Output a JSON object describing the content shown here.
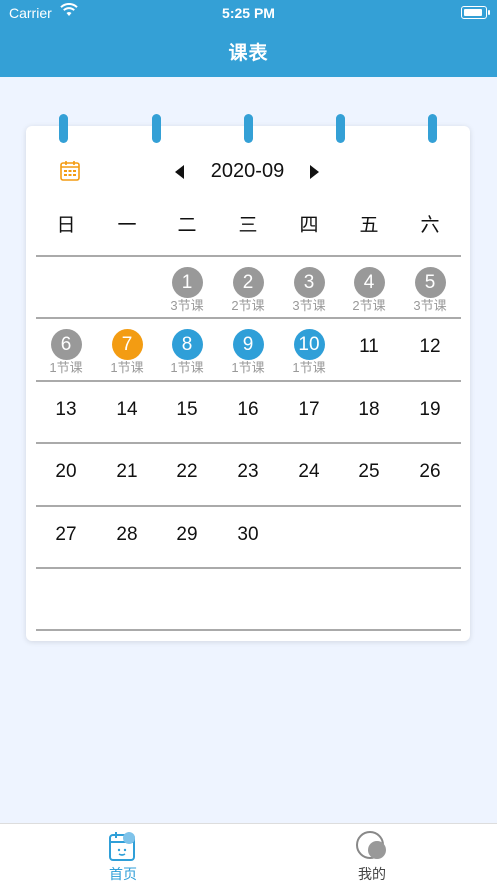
{
  "status_bar": {
    "carrier": "Carrier",
    "time": "5:25 PM"
  },
  "header": {
    "title": "课表"
  },
  "calendar": {
    "month": "2020-09",
    "weekdays": [
      "日",
      "一",
      "二",
      "三",
      "四",
      "五",
      "六"
    ],
    "rows": [
      [
        {
          "day": "",
          "sub": "",
          "color": ""
        },
        {
          "day": "",
          "sub": "",
          "color": ""
        },
        {
          "day": "1",
          "sub": "3节课",
          "color": "gray"
        },
        {
          "day": "2",
          "sub": "2节课",
          "color": "gray"
        },
        {
          "day": "3",
          "sub": "3节课",
          "color": "gray"
        },
        {
          "day": "4",
          "sub": "2节课",
          "color": "gray"
        },
        {
          "day": "5",
          "sub": "3节课",
          "color": "gray"
        }
      ],
      [
        {
          "day": "6",
          "sub": "1节课",
          "color": "gray"
        },
        {
          "day": "7",
          "sub": "1节课",
          "color": "orange"
        },
        {
          "day": "8",
          "sub": "1节课",
          "color": "blue"
        },
        {
          "day": "9",
          "sub": "1节课",
          "color": "blue"
        },
        {
          "day": "10",
          "sub": "1节课",
          "color": "blue"
        },
        {
          "day": "11",
          "sub": "",
          "color": ""
        },
        {
          "day": "12",
          "sub": "",
          "color": ""
        }
      ],
      [
        {
          "day": "13"
        },
        {
          "day": "14"
        },
        {
          "day": "15"
        },
        {
          "day": "16"
        },
        {
          "day": "17"
        },
        {
          "day": "18"
        },
        {
          "day": "19"
        }
      ],
      [
        {
          "day": "20"
        },
        {
          "day": "21"
        },
        {
          "day": "22"
        },
        {
          "day": "23"
        },
        {
          "day": "24"
        },
        {
          "day": "25"
        },
        {
          "day": "26"
        }
      ],
      [
        {
          "day": "27"
        },
        {
          "day": "28"
        },
        {
          "day": "29"
        },
        {
          "day": "30"
        },
        {
          "day": ""
        },
        {
          "day": ""
        },
        {
          "day": ""
        }
      ],
      [
        {
          "day": ""
        },
        {
          "day": ""
        },
        {
          "day": ""
        },
        {
          "day": ""
        },
        {
          "day": ""
        },
        {
          "day": ""
        },
        {
          "day": ""
        }
      ]
    ]
  },
  "tabbar": {
    "home_label": "首页",
    "mine_label": "我的"
  },
  "colors": {
    "accent": "#34a0d6",
    "today": "#f39c12",
    "past": "#999999",
    "scheduled": "#2f9fd8"
  },
  "icons": {
    "calendar": "calendar-icon",
    "prev": "caret-left-icon",
    "next": "caret-right-icon",
    "home": "home-tab-icon",
    "mine": "profile-tab-icon"
  }
}
